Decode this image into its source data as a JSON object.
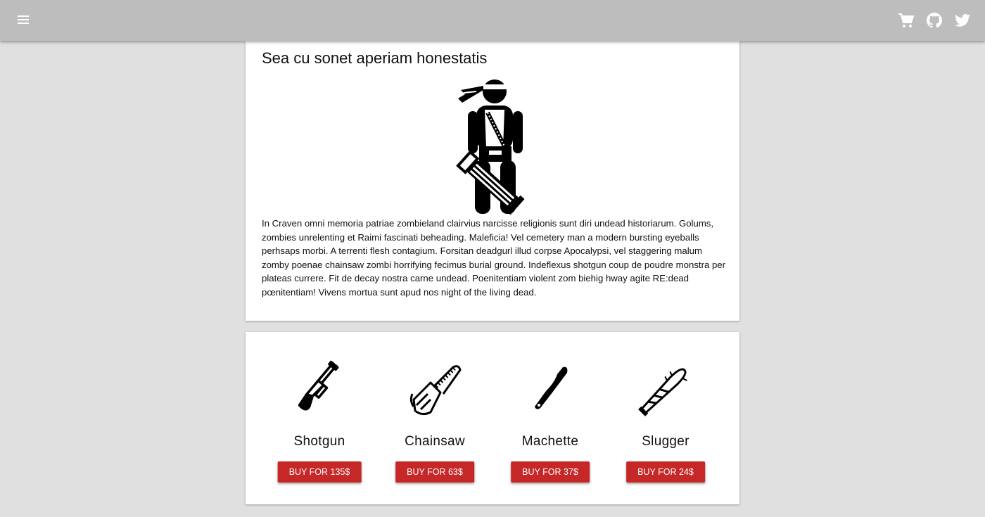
{
  "topbar": {
    "icons": [
      "menu-icon",
      "cart-icon",
      "github-icon",
      "twitter-icon"
    ],
    "background": "#bdbdbd"
  },
  "article": {
    "title": "Sea cu sonet aperiam honestatis",
    "image": "survivor-minigun-icon",
    "body": "In Craven omni memoria patriae zombieland clairvius narcisse religionis sunt diri undead historiarum. Golums, zombies unrelenting et Raimi fascinati beheading. Maleficia! Vel cemetery man a modern bursting eyeballs perhsaps morbi. A terrenti flesh contagium. Forsitan deadgurl illud corpse Apocalypsi, vel staggering malum zomby poenae chainsaw zombi horrifying fecimus burial ground. Indeflexus shotgun coup de poudre monstra per plateas currere. Fit de decay nostra carne undead. Poenitentiam violent zom biehig hway agite RE:dead pœnitentiam! Vivens mortua sunt apud nos night of the living dead."
  },
  "products": [
    {
      "name": "Shotgun",
      "icon": "shotgun-icon",
      "buy_label": "Buy for 135$"
    },
    {
      "name": "Chainsaw",
      "icon": "chainsaw-icon",
      "buy_label": "Buy for 63$"
    },
    {
      "name": "Machette",
      "icon": "machete-icon",
      "buy_label": "Buy for 37$"
    },
    {
      "name": "Slugger",
      "icon": "bat-icon",
      "buy_label": "Buy for 24$"
    }
  ],
  "colors": {
    "page_background": "#e0e0e0",
    "buy_button": "#c62828",
    "card": "#ffffff"
  }
}
